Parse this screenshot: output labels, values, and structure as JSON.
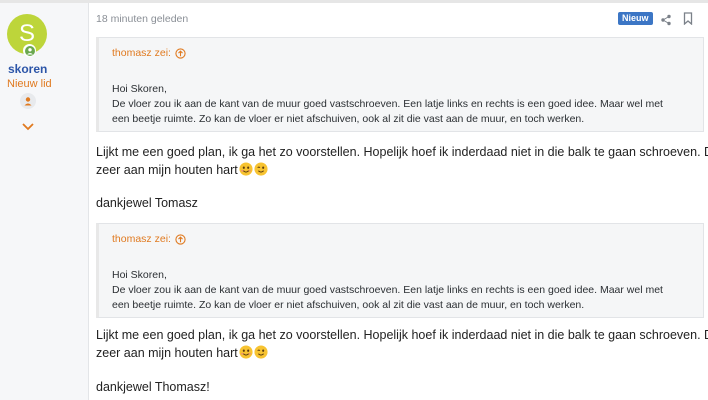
{
  "user": {
    "initial": "S",
    "name": "skoren",
    "rank": "Nieuw lid"
  },
  "post": {
    "time": "18 minuten geleden",
    "badge": "Nieuw",
    "quotes": [
      {
        "author": "thomasz zei:",
        "greeting": "Hoi Skoren,",
        "line1": "De vloer zou ik aan de kant van de muur goed vastschroeven. Een latje links en rechts is een goed idee. Maar wel met",
        "line2": "een beetje ruimte. Zo kan de vloer er niet afschuiven, ook al zit die vast aan de muur, en toch werken."
      },
      {
        "author": "thomasz zei:",
        "greeting": "Hoi Skoren,",
        "line1": "De vloer zou ik aan de kant van de muur goed vastschroeven. Een latje links en rechts is een goed idee. Maar wel met",
        "line2": "een beetje ruimte. Zo kan de vloer er niet afschuiven, ook al zit die vast aan de muur, en toch werken."
      }
    ],
    "replies": [
      {
        "line1": "Lijkt me een goed plan, ik ga het zo voorstellen. Hopelijk hoef ik inderdaad niet in die balk te gaan schroeven. Doet",
        "line2": "zeer aan mijn houten hart"
      },
      {
        "line1": "Lijkt me een goed plan, ik ga het zo voorstellen. Hopelijk hoef ik inderdaad niet in die balk te gaan schroeven. Doet",
        "line2": "zeer aan mijn houten hart"
      }
    ],
    "thanks1": "dankjewel Tomasz",
    "thanks2": "dankjewel Thomasz!"
  },
  "icons": [
    "online-status-icon",
    "badge-icon",
    "expand-chevron-icon",
    "share-icon",
    "bookmark-icon",
    "quote-arrow-icon",
    "smile-emoji",
    "wink-emoji"
  ],
  "colors": {
    "avatar": "#bdd53a",
    "username": "#2c55a8",
    "rank": "#e07a20",
    "badge": "#3c76c5",
    "quote_author": "#e07a20"
  }
}
